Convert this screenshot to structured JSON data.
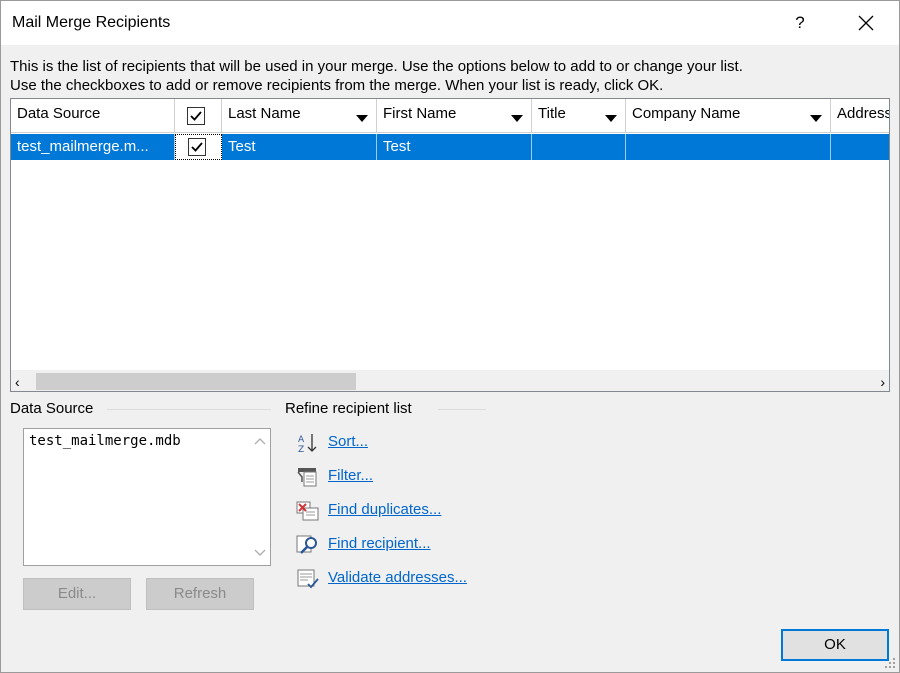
{
  "window": {
    "title": "Mail Merge Recipients",
    "help_label": "?",
    "close_icon": "close-icon"
  },
  "instructions": {
    "line1": "This is the list of recipients that will be used in your merge.  Use the options below to add to or change your list.",
    "line2": "Use the checkboxes to add or remove recipients from the merge.  When your list is ready, click OK."
  },
  "grid": {
    "columns": [
      {
        "label": "Data Source",
        "has_dropdown": false
      },
      {
        "label": "",
        "checkbox": true,
        "checked": true
      },
      {
        "label": "Last Name",
        "has_dropdown": true
      },
      {
        "label": "First Name",
        "has_dropdown": true
      },
      {
        "label": "Title",
        "has_dropdown": true
      },
      {
        "label": "Company Name",
        "has_dropdown": true
      },
      {
        "label": "Address",
        "has_dropdown": false
      }
    ],
    "rows": [
      {
        "data_source": "test_mailmerge.m...",
        "checked": true,
        "last_name": "Test",
        "first_name": "Test",
        "title": "",
        "company_name": "",
        "address": ""
      }
    ],
    "selection_color": "#0078d7"
  },
  "data_source": {
    "label": "Data Source",
    "items": [
      "test_mailmerge.mdb"
    ],
    "edit_label": "Edit...",
    "refresh_label": "Refresh"
  },
  "refine": {
    "label": "Refine recipient list",
    "items": [
      {
        "label": "Sort...",
        "icon": "sort-az-icon"
      },
      {
        "label": "Filter...",
        "icon": "filter-icon"
      },
      {
        "label": "Find duplicates...",
        "icon": "find-duplicates-icon"
      },
      {
        "label": "Find recipient...",
        "icon": "find-recipient-icon"
      },
      {
        "label": "Validate addresses...",
        "icon": "validate-addresses-icon"
      }
    ]
  },
  "footer": {
    "ok_label": "OK"
  },
  "colors": {
    "link": "#0066cc",
    "dialog_bg": "#f0f0f0",
    "ok_border": "#0078d7"
  }
}
